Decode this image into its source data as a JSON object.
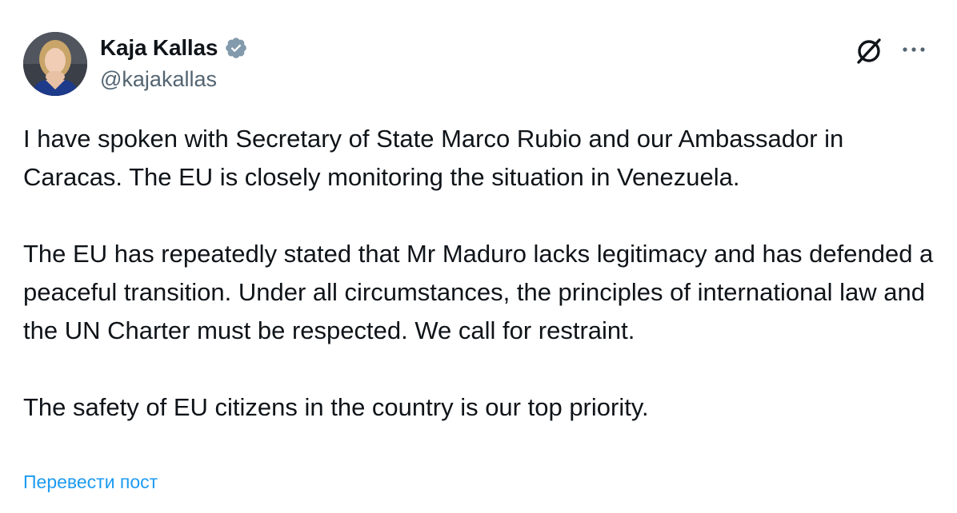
{
  "author": {
    "display_name": "Kaja Kallas",
    "handle": "@kajakallas",
    "verified_icon": "verified-badge-icon",
    "verified_color": "#829aab"
  },
  "actions": {
    "grok_icon": "grok-icon",
    "more_icon": "more-options-icon"
  },
  "post": {
    "paragraphs": [
      "I have spoken with Secretary of State Marco Rubio and our Ambassador in Caracas. The EU is closely monitoring the situation in Venezuela.",
      "The EU has repeatedly stated that Mr Maduro lacks legitimacy and has defended a peaceful transition. Under all circumstances, the principles of international law and the UN Charter must be respected. We call for restraint.",
      "The safety of EU citizens in the country is our top priority."
    ],
    "translate_label": "Перевести пост"
  },
  "colors": {
    "text": "#0f1419",
    "secondary_text": "#536471",
    "link": "#1d9bf0"
  }
}
